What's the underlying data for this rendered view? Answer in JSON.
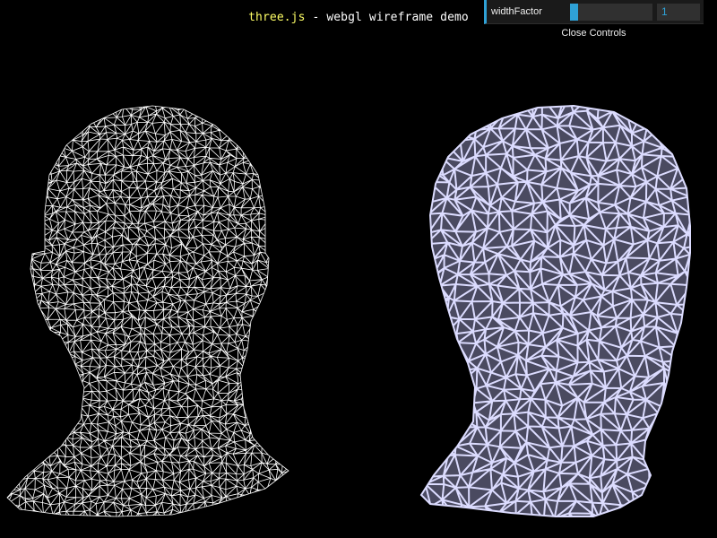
{
  "header": {
    "link_text": "three.js",
    "description": " - webgl wireframe demo"
  },
  "gui": {
    "param_label": "widthFactor",
    "param_value": "1",
    "slider_fraction": 0.1,
    "close_label": "Close Controls"
  },
  "colors": {
    "background": "#000000",
    "link": "#ffff66",
    "gui_accent": "#2fa1d6",
    "wire_thin": "#ffffff",
    "wire_thick": "#dcdcff"
  },
  "scene": {
    "models": [
      "thin-wireframe-head",
      "thick-wireframe-head"
    ]
  }
}
